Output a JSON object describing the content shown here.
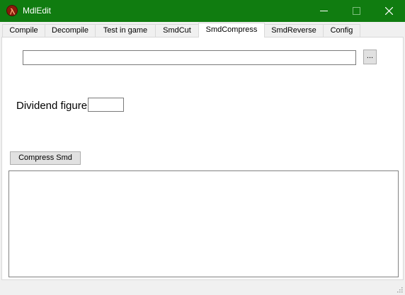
{
  "window": {
    "title": "MdlEdit",
    "accent_color": "#107c10"
  },
  "tabs": [
    {
      "label": "Compile"
    },
    {
      "label": "Decompile"
    },
    {
      "label": "Test in game"
    },
    {
      "label": "SmdCut"
    },
    {
      "label": "SmdCompress",
      "active": true
    },
    {
      "label": "SmdReverse"
    },
    {
      "label": "Config"
    }
  ],
  "form": {
    "path_value": "",
    "browse_label": "...",
    "dividend_label": "Dividend figure",
    "dividend_value": "",
    "compress_label": "Compress Smd",
    "output_text": ""
  },
  "icons": {
    "app": "half-life-lambda-icon",
    "minimize": "minimize-icon",
    "maximize": "maximize-icon",
    "close": "close-icon",
    "grip": "resize-grip-icon"
  }
}
